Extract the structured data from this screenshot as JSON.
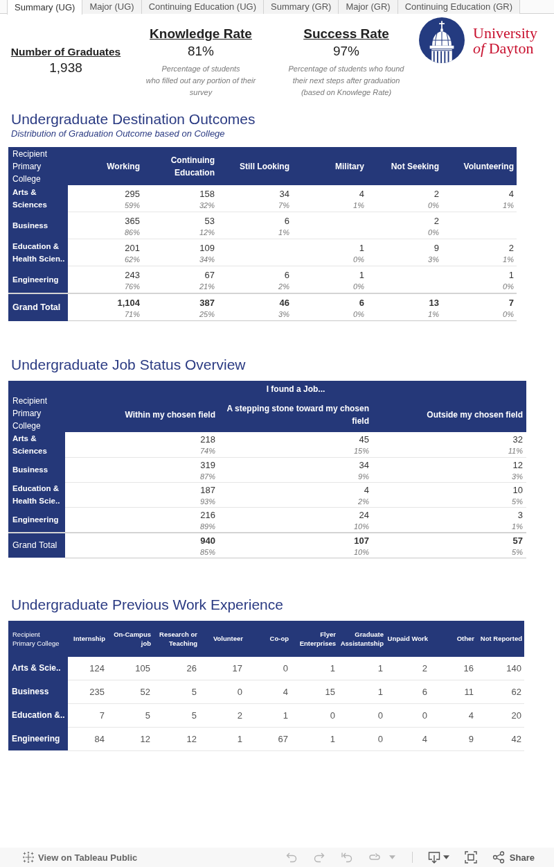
{
  "tabs": [
    {
      "label": "Summary (UG)",
      "selected": true
    },
    {
      "label": "Major (UG)",
      "selected": false
    },
    {
      "label": "Continuing Education (UG)",
      "selected": false
    },
    {
      "label": "Summary (GR)",
      "selected": false
    },
    {
      "label": "Major (GR)",
      "selected": false
    },
    {
      "label": "Continuing Education (GR)",
      "selected": false
    }
  ],
  "kpis": [
    {
      "title": "Number of Graduates",
      "value": "1,938"
    },
    {
      "title": "Knowledge Rate",
      "value": "81%",
      "note": [
        "Percentage of students",
        "who filled out any portion of their",
        "survey"
      ]
    },
    {
      "title": "Success Rate",
      "value": "97%",
      "note": [
        "Percentage of students who found",
        "their next steps after graduation",
        "(based on Knowlege Rate)"
      ]
    }
  ],
  "logo": {
    "lines": [
      "University",
      "*of* Dayton"
    ]
  },
  "outcomes": {
    "title": "Undergraduate Destination Outcomes",
    "subtitle": "Distribution of Graduation Outcome based on College",
    "columns": [
      "Recipient Primary College",
      "Working",
      "Continuing Education",
      "Still Looking",
      "Military",
      "Not Seeking",
      "Volunteering"
    ],
    "rows": [
      {
        "kind": "college",
        "cells": [
          "Arts & Sciences",
          {
            "count": "295",
            "share": "59%"
          },
          {
            "count": "158",
            "share": "32%"
          },
          {
            "count": "34",
            "share": "7%"
          },
          {
            "count": "4",
            "share": "1%"
          },
          {
            "count": "2",
            "share": "0%"
          },
          {
            "count": "4",
            "share": "1%"
          }
        ]
      },
      {
        "kind": "college",
        "cells": [
          "Business",
          {
            "count": "365",
            "share": "86%"
          },
          {
            "count": "53",
            "share": "12%"
          },
          {
            "count": "6",
            "share": "1%"
          },
          null,
          {
            "count": "2",
            "share": "0%"
          },
          null
        ]
      },
      {
        "kind": "college",
        "cells": [
          "Education & Health Scien..",
          {
            "count": "201",
            "share": "62%"
          },
          {
            "count": "109",
            "share": "34%"
          },
          null,
          {
            "count": "1",
            "share": "0%"
          },
          {
            "count": "9",
            "share": "3%"
          },
          {
            "count": "2",
            "share": "1%"
          }
        ]
      },
      {
        "kind": "college",
        "cells": [
          "Engineering",
          {
            "count": "243",
            "share": "76%"
          },
          {
            "count": "67",
            "share": "21%"
          },
          {
            "count": "6",
            "share": "2%"
          },
          {
            "count": "1",
            "share": "0%"
          },
          null,
          {
            "count": "1",
            "share": "0%"
          }
        ]
      },
      {
        "kind": "total",
        "cells": [
          "Grand Total",
          {
            "count": "1,104",
            "share": "71%"
          },
          {
            "count": "387",
            "share": "25%"
          },
          {
            "count": "46",
            "share": "3%"
          },
          {
            "count": "6",
            "share": "0%"
          },
          {
            "count": "13",
            "share": "1%"
          },
          {
            "count": "7",
            "share": "0%"
          }
        ]
      }
    ]
  },
  "job_status": {
    "title": "Undergraduate Job Status Overview",
    "group_header": "I found a Job...",
    "columns": [
      "Recipient Primary College",
      "Within my chosen field",
      "A stepping stone toward my chosen field",
      "Outside my chosen field"
    ],
    "rows": [
      {
        "kind": "college",
        "cells": [
          "Arts & Sciences",
          {
            "count": "218",
            "share": "74%"
          },
          {
            "count": "45",
            "share": "15%"
          },
          {
            "count": "32",
            "share": "11%"
          }
        ]
      },
      {
        "kind": "college",
        "cells": [
          "Business",
          {
            "count": "319",
            "share": "87%"
          },
          {
            "count": "34",
            "share": "9%"
          },
          {
            "count": "12",
            "share": "3%"
          }
        ]
      },
      {
        "kind": "college",
        "cells": [
          "Education & Health Scie..",
          {
            "count": "187",
            "share": "93%"
          },
          {
            "count": "4",
            "share": "2%"
          },
          {
            "count": "10",
            "share": "5%"
          }
        ]
      },
      {
        "kind": "college",
        "cells": [
          "Engineering",
          {
            "count": "216",
            "share": "89%"
          },
          {
            "count": "24",
            "share": "10%"
          },
          {
            "count": "3",
            "share": "1%"
          }
        ]
      },
      {
        "kind": "total",
        "cells": [
          "Grand Total",
          {
            "count": "940",
            "share": "85%"
          },
          {
            "count": "107",
            "share": "10%"
          },
          {
            "count": "57",
            "share": "5%"
          }
        ]
      }
    ]
  },
  "work_experience": {
    "title": "Undergraduate Previous Work Experience",
    "columns": [
      "Recipient Primary College",
      "Internship",
      "On-Campus job",
      "Research or Teaching",
      "Volunteer",
      "Co-op",
      "Flyer Enterprises",
      "Graduate Assistantship",
      "Unpaid Work",
      "Other",
      "Not Reported"
    ],
    "rows": [
      [
        "Arts & Scie..",
        "124",
        "105",
        "26",
        "17",
        "0",
        "1",
        "1",
        "2",
        "16",
        "140"
      ],
      [
        "Business",
        "235",
        "52",
        "5",
        "0",
        "4",
        "15",
        "1",
        "6",
        "11",
        "62"
      ],
      [
        "Education &..",
        "7",
        "5",
        "5",
        "2",
        "1",
        "0",
        "0",
        "0",
        "4",
        "20"
      ],
      [
        "Engineering",
        "84",
        "12",
        "12",
        "1",
        "67",
        "1",
        "0",
        "4",
        "9",
        "42"
      ]
    ]
  },
  "toolbar": {
    "link": "View on Tableau Public",
    "buttons": [
      {
        "kind": "undo",
        "disabled": true
      },
      {
        "kind": "redo",
        "disabled": true
      },
      {
        "kind": "revert",
        "disabled": true
      },
      {
        "kind": "refresh",
        "disabled": true
      },
      {
        "kind": "more",
        "disabled": true
      },
      {
        "kind": "download",
        "disabled": false
      },
      {
        "kind": "fullscreen",
        "disabled": false
      },
      {
        "kind": "share",
        "label": "Share",
        "disabled": false
      }
    ]
  }
}
